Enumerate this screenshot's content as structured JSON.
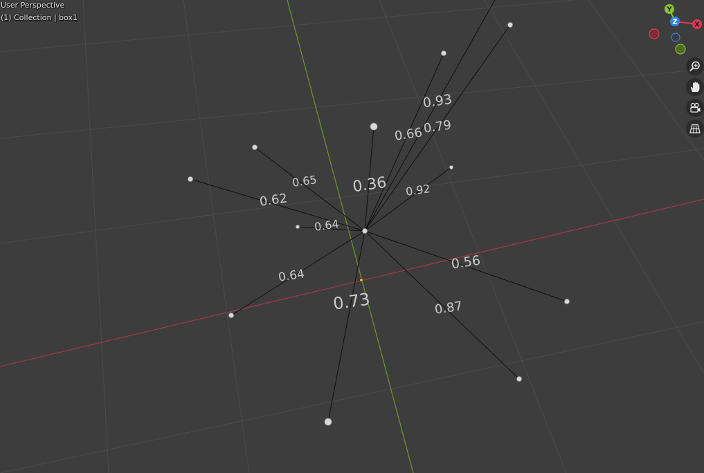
{
  "viewport": {
    "view_name": "User Perspective",
    "collection_line": "(1) Collection | box1"
  },
  "gizmo": {
    "x_label": "X",
    "y_label": "Y",
    "z_label": "Z",
    "x_color": "#e0394f",
    "y_color": "#8bc233",
    "z_color": "#2f86e8"
  },
  "nav_buttons": {
    "zoom": "zoom-icon",
    "pan": "hand-icon",
    "camera": "camera-icon",
    "projection": "grid-icon"
  },
  "edges": [
    {
      "label": "0.93"
    },
    {
      "label": "0.66"
    },
    {
      "label": "0.79"
    },
    {
      "label": "0.36"
    },
    {
      "label": "0.92"
    },
    {
      "label": "0.65"
    },
    {
      "label": "0.62"
    },
    {
      "label": "0.64"
    },
    {
      "label": "0.56"
    },
    {
      "label": "0.64"
    },
    {
      "label": "0.73"
    },
    {
      "label": "0.87"
    }
  ],
  "colors": {
    "background": "#3d3d3d",
    "grid": "#4a4a4a",
    "x_axis_line": "#9c3a49",
    "y_axis_line": "#6e8f2a",
    "edge": "#101010"
  }
}
